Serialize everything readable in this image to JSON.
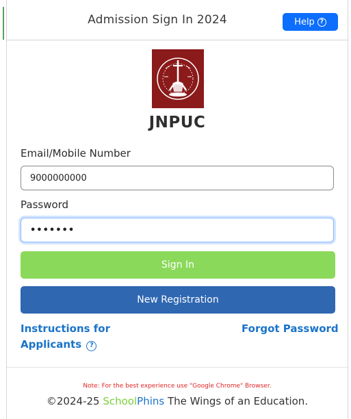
{
  "header": {
    "title": "Admission Sign In 2024",
    "help_label": "Help",
    "help_icon": "question-circle-icon"
  },
  "logo": {
    "motto_top": "LET YOUR LIGHT SHINE",
    "motto_bottom": "तमसो मा ज्योतिर्गमय",
    "color": "#8b1a1a"
  },
  "brand": {
    "name": "JNPUC"
  },
  "form": {
    "email_label": "Email/Mobile Number",
    "email_value": "9000000000",
    "password_label": "Password",
    "password_value": "•••••••"
  },
  "buttons": {
    "signin_label": "Sign In",
    "register_label": "New Registration",
    "signin_color": "#8bd95a",
    "register_color": "#2f67b1"
  },
  "links": {
    "instructions_line1": "Instructions for",
    "instructions_line2": "Applicants",
    "instructions_icon": "question-circle-icon",
    "forgot_password": "Forgot Password"
  },
  "footer": {
    "note": "Note: For the best experience use \"Google Chrome\" Browser.",
    "copyright_prefix": "©2024-25",
    "brand_part1": "School",
    "brand_part2": "Phins",
    "tagline": "The Wings of an Education."
  }
}
